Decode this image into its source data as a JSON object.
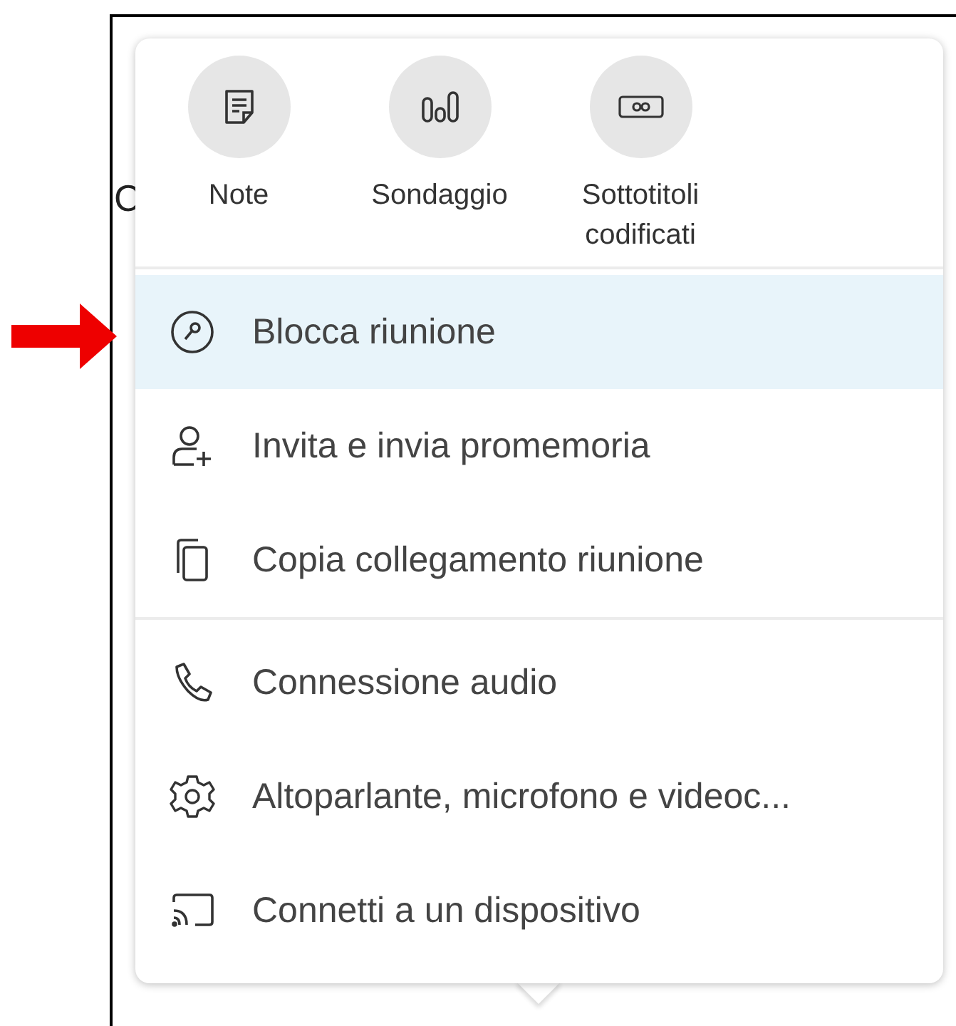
{
  "background_text": "C",
  "quick_actions": [
    {
      "label": "Note"
    },
    {
      "label": "Sondaggio"
    },
    {
      "label": "Sottotitoli codificati"
    }
  ],
  "menu_sections": [
    {
      "items": [
        {
          "label": "Blocca riunione",
          "selected": true
        },
        {
          "label": "Invita e invia promemoria",
          "selected": false
        },
        {
          "label": "Copia collegamento riunione",
          "selected": false
        }
      ]
    },
    {
      "items": [
        {
          "label": "Connessione audio",
          "selected": false
        },
        {
          "label": "Altoparlante, microfono e videoc...",
          "selected": false
        },
        {
          "label": "Connetti a un dispositivo",
          "selected": false
        }
      ]
    }
  ]
}
